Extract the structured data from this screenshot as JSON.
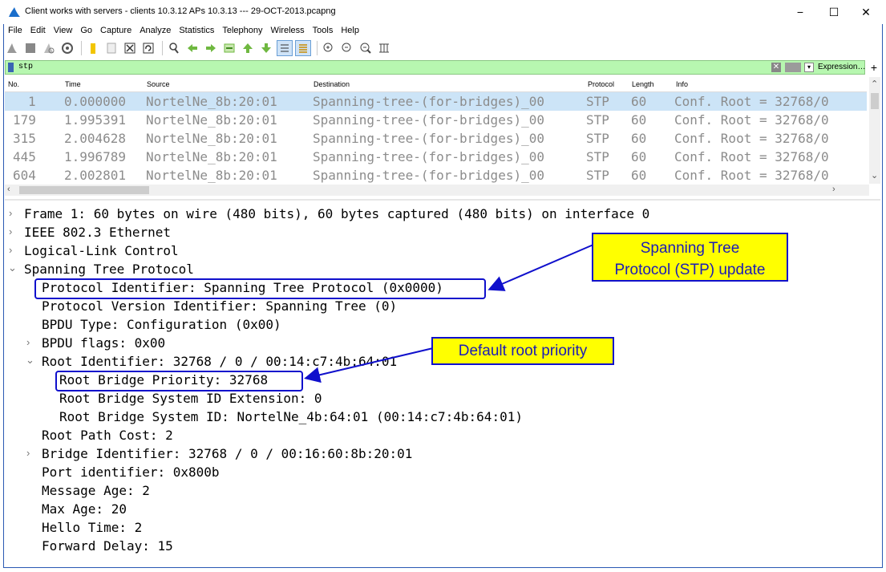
{
  "window": {
    "title": "Client works with servers - clients 10.3.12 APs 10.3.13 --- 29-OCT-2013.pcapng",
    "minimize": "−",
    "maximize": "☐",
    "close": "✕"
  },
  "menu": [
    "File",
    "Edit",
    "View",
    "Go",
    "Capture",
    "Analyze",
    "Statistics",
    "Telephony",
    "Wireless",
    "Tools",
    "Help"
  ],
  "filter": {
    "value": "stp",
    "clear": "✕",
    "dropdown": "▾",
    "expression_label": "Expression…",
    "plus": "+"
  },
  "packet_list": {
    "columns": [
      "No.",
      "Time",
      "Source",
      "Destination",
      "Protocol",
      "Length",
      "Info"
    ],
    "rows": [
      {
        "no": "1",
        "time": "0.000000",
        "source": "NortelNe_8b:20:01",
        "destination": "Spanning-tree-(for-bridges)_00",
        "protocol": "STP",
        "length": "60",
        "info": "Conf. Root = 32768/0"
      },
      {
        "no": "179",
        "time": "1.995391",
        "source": "NortelNe_8b:20:01",
        "destination": "Spanning-tree-(for-bridges)_00",
        "protocol": "STP",
        "length": "60",
        "info": "Conf. Root = 32768/0"
      },
      {
        "no": "315",
        "time": "2.004628",
        "source": "NortelNe_8b:20:01",
        "destination": "Spanning-tree-(for-bridges)_00",
        "protocol": "STP",
        "length": "60",
        "info": "Conf. Root = 32768/0"
      },
      {
        "no": "445",
        "time": "1.996789",
        "source": "NortelNe_8b:20:01",
        "destination": "Spanning-tree-(for-bridges)_00",
        "protocol": "STP",
        "length": "60",
        "info": "Conf. Root = 32768/0"
      },
      {
        "no": "604",
        "time": "2.002801",
        "source": "NortelNe_8b:20:01",
        "destination": "Spanning-tree-(for-bridges)_00",
        "protocol": "STP",
        "length": "60",
        "info": "Conf. Root = 32768/0"
      }
    ]
  },
  "details": {
    "frame": "Frame 1: 60 bytes on wire (480 bits), 60 bytes captured (480 bits) on interface 0",
    "ethernet": "IEEE 802.3 Ethernet",
    "llc": "Logical-Link Control",
    "stp": "Spanning Tree Protocol",
    "protocol_identifier": "Protocol Identifier: Spanning Tree Protocol (0x0000)",
    "protocol_version": "Protocol Version Identifier: Spanning Tree (0)",
    "bpdu_type": "BPDU Type: Configuration (0x00)",
    "bpdu_flags": "BPDU flags: 0x00",
    "root_identifier": "Root Identifier: 32768 / 0 / 00:14:c7:4b:64:01",
    "root_bridge_priority": "Root Bridge Priority: 32768",
    "root_bridge_sysid_ext": "Root Bridge System ID Extension: 0",
    "root_bridge_sysid": "Root Bridge System ID: NortelNe_4b:64:01 (00:14:c7:4b:64:01)",
    "root_path_cost": "Root Path Cost: 2",
    "bridge_identifier": "Bridge Identifier: 32768 / 0 / 00:16:60:8b:20:01",
    "port_identifier": "Port identifier: 0x800b",
    "message_age": "Message Age: 2",
    "max_age": "Max Age: 20",
    "hello_time": "Hello Time: 2",
    "forward_delay": "Forward Delay: 15"
  },
  "annotations": {
    "stp_update_line1": "Spanning Tree",
    "stp_update_line2": "Protocol (STP) update",
    "default_root_priority": "Default root priority"
  },
  "colors": {
    "annotation_fill": "#ffff00",
    "annotation_border": "#1010cc",
    "filter_bg": "#b7f7b0",
    "selected_row": "#cce4f7"
  }
}
